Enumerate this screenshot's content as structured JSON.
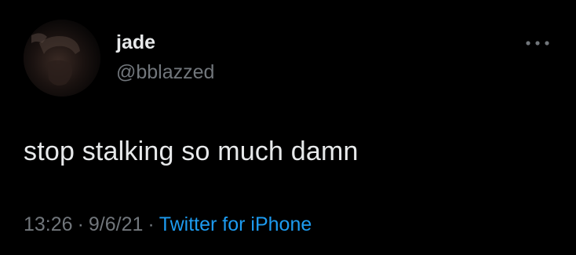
{
  "user": {
    "name": "jade",
    "handle": "@bblazzed"
  },
  "tweet": {
    "text": "stop stalking so much damn",
    "time": "13:26",
    "date": "9/6/21",
    "source": "Twitter for iPhone",
    "separator": "·"
  },
  "icons": {
    "more": "more-dots-icon",
    "avatar": "avatar"
  },
  "colors": {
    "background": "#000000",
    "text": "#e7e9ea",
    "muted": "#71767b",
    "link": "#1d9bf0"
  }
}
